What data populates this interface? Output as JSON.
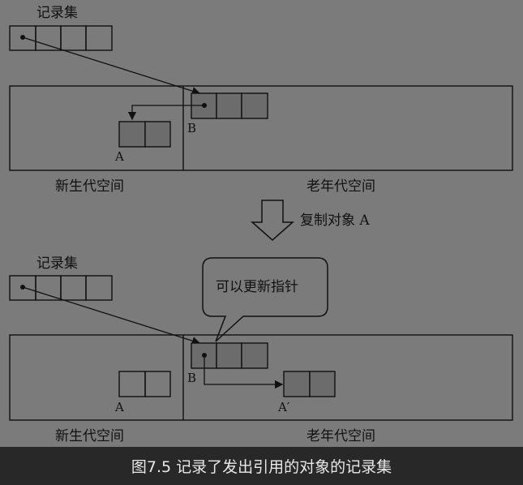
{
  "figure": {
    "top_panel": {
      "remembered_set_label": "记录集",
      "young_gen_label": "新生代空间",
      "old_gen_label": "老年代空间",
      "object_a_label": "A",
      "object_b_label": "B"
    },
    "transition": {
      "label": "复制对象 A"
    },
    "bottom_panel": {
      "remembered_set_label": "记录集",
      "young_gen_label": "新生代空间",
      "old_gen_label": "老年代空间",
      "object_a_label": "A",
      "object_b_label": "B",
      "object_a_prime_label": "A′",
      "callout_text": "可以更新指针"
    }
  },
  "caption": "图7.5  记录了发出引用的对象的记录集",
  "colors": {
    "figure_background": "#7b7b7b",
    "object_fill": "#6c6c6c",
    "page_background": "#2b2b2b"
  }
}
